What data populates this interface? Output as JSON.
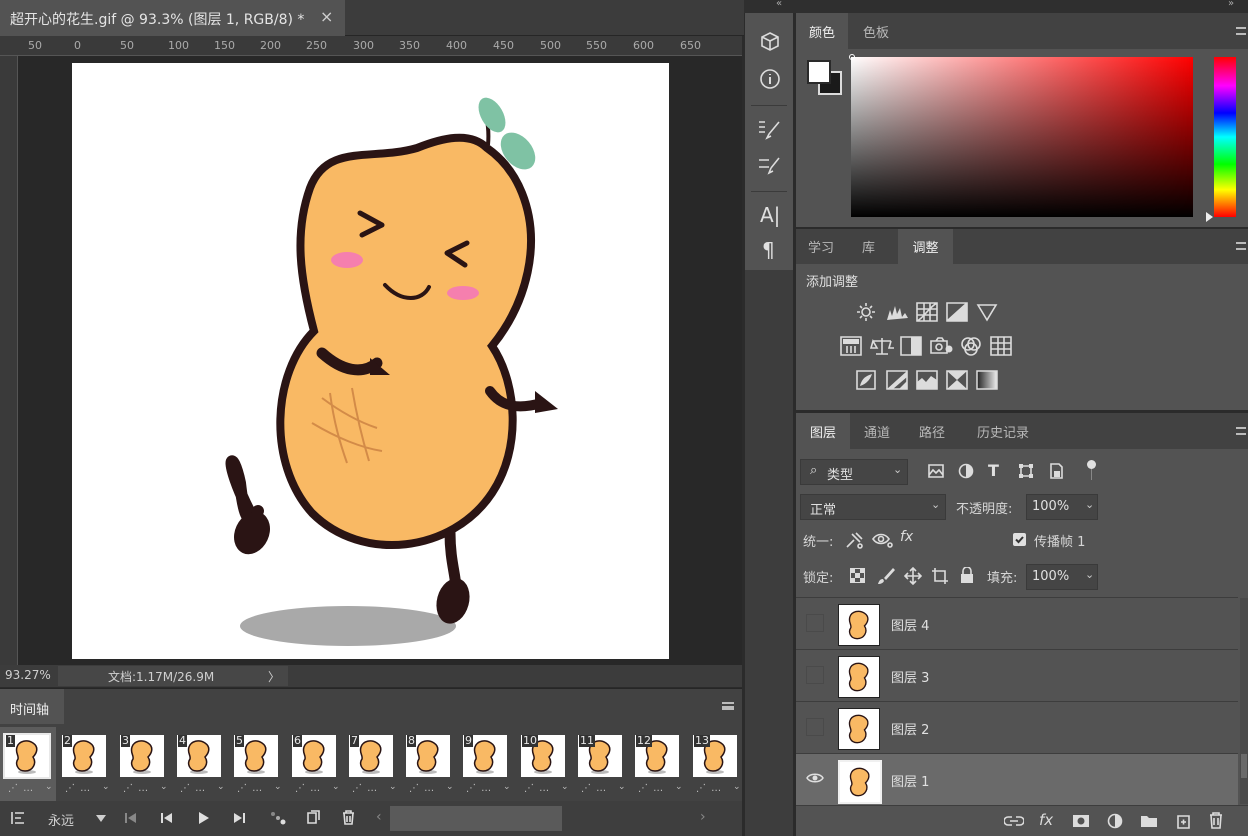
{
  "document": {
    "tab_title": "超开心的花生.gif @ 93.3% (图层 1, RGB/8) *",
    "close_glyph": "×",
    "ruler_labels": [
      "50",
      "0",
      "50",
      "100",
      "150",
      "200",
      "250",
      "300",
      "350",
      "400",
      "450",
      "500",
      "550",
      "600",
      "650"
    ],
    "zoom": "93.27%",
    "doc_info": "文档:1.17M/26.9M",
    "status_arrow": "〉"
  },
  "timeline": {
    "title": "时间轴",
    "loop": "永远",
    "frames": [
      "1",
      "2",
      "3",
      "4",
      "5",
      "6",
      "7",
      "8",
      "9",
      "10",
      "11",
      "12",
      "13"
    ],
    "delay_glyph": "⋰ …",
    "arrow_glyph": "⌄",
    "scroll_left": "‹",
    "scroll_right": "›"
  },
  "color_panel": {
    "tabs": [
      "颜色",
      "色板"
    ],
    "foreground": "#ffffff",
    "background": "#1a1a1a"
  },
  "adjust_panel": {
    "tabs": [
      "学习",
      "库",
      "调整"
    ],
    "heading": "添加调整"
  },
  "layers_panel": {
    "tabs": [
      "图层",
      "通道",
      "路径",
      "历史记录"
    ],
    "filter_label": "类型",
    "blend_mode": "正常",
    "opacity_label": "不透明度:",
    "opacity_value": "100%",
    "unify_label": "统一:",
    "propagate_label": "传播帧 1",
    "lock_label": "锁定:",
    "fill_label": "填充:",
    "fill_value": "100%",
    "layers": [
      "图层 4",
      "图层 3",
      "图层 2",
      "图层 1"
    ],
    "fx_label": "fx"
  },
  "tools": {
    "text_tool": "A|",
    "paragraph_tool": "¶"
  },
  "colors": {
    "peanut": "#f9b964",
    "outline": "#2a1414",
    "panel": "#535353",
    "panel_dark": "#424242"
  }
}
